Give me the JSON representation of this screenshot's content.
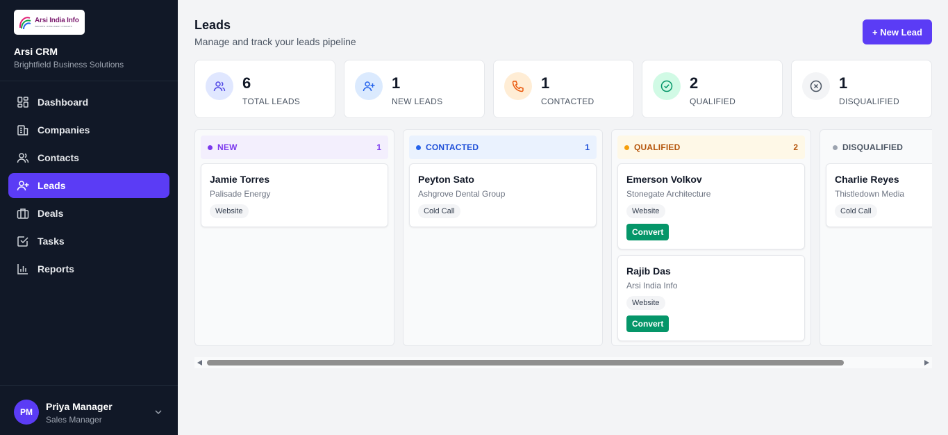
{
  "sidebar": {
    "logo_text": "Arsi India Info",
    "logo_tagline": "INNOVATE • INTELLIGENT • INSIGHTS",
    "app_name": "Arsi CRM",
    "org_name": "Brightfield Business Solutions",
    "nav": [
      {
        "label": "Dashboard",
        "icon": "dashboard-icon"
      },
      {
        "label": "Companies",
        "icon": "building-icon"
      },
      {
        "label": "Contacts",
        "icon": "users-icon"
      },
      {
        "label": "Leads",
        "icon": "user-plus-icon",
        "active": true
      },
      {
        "label": "Deals",
        "icon": "briefcase-icon"
      },
      {
        "label": "Tasks",
        "icon": "checkbox-icon"
      },
      {
        "label": "Reports",
        "icon": "bar-chart-icon"
      }
    ],
    "user": {
      "initials": "PM",
      "name": "Priya Manager",
      "role": "Sales Manager"
    }
  },
  "header": {
    "title": "Leads",
    "subtitle": "Manage and track your leads pipeline",
    "new_lead_label": "+ New Lead"
  },
  "stats": [
    {
      "value": "6",
      "label": "TOTAL LEADS",
      "icon": "users-icon"
    },
    {
      "value": "1",
      "label": "NEW LEADS",
      "icon": "user-plus-icon"
    },
    {
      "value": "1",
      "label": "CONTACTED",
      "icon": "phone-icon"
    },
    {
      "value": "2",
      "label": "QUALIFIED",
      "icon": "check-circle-icon"
    },
    {
      "value": "1",
      "label": "DISQUALIFIED",
      "icon": "x-circle-icon"
    }
  ],
  "columns": [
    {
      "title": "NEW",
      "count": "1",
      "color": "#7c3aed",
      "cards": [
        {
          "name": "Jamie Torres",
          "company": "Palisade Energy",
          "source": "Website"
        }
      ]
    },
    {
      "title": "CONTACTED",
      "count": "1",
      "color": "#2563eb",
      "cards": [
        {
          "name": "Peyton Sato",
          "company": "Ashgrove Dental Group",
          "source": "Cold Call"
        }
      ]
    },
    {
      "title": "QUALIFIED",
      "count": "2",
      "color": "#d97706",
      "cards": [
        {
          "name": "Emerson Volkov",
          "company": "Stonegate Architecture",
          "source": "Website",
          "action": "Convert"
        },
        {
          "name": "Rajib Das",
          "company": "Arsi India Info",
          "source": "Website",
          "action": "Convert"
        }
      ]
    },
    {
      "title": "DISQUALIFIED",
      "count": "",
      "color": "#6b7280",
      "cards": [
        {
          "name": "Charlie Reyes",
          "company": "Thistledown Media",
          "source": "Cold Call"
        }
      ]
    }
  ],
  "colors": {
    "sidebar_bg": "#111827",
    "accent": "#5b3cf5",
    "convert_green": "#059669"
  }
}
